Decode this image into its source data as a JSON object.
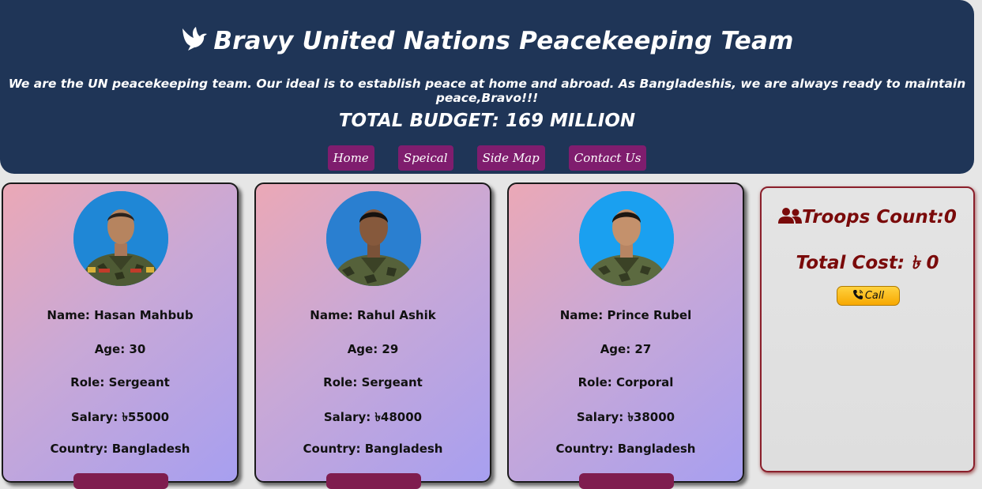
{
  "header": {
    "title": "Bravy United Nations Peacekeeping Team",
    "tagline": "We are the UN peacekeeping team. Our ideal is to establish peace at home and abroad. As Bangladeshis, we are always ready to maintain peace,Bravo!!!",
    "budget": "TOTAL BUDGET: 169 MILLION",
    "logo_icon": "dove-icon",
    "bg_color": "#1f3557"
  },
  "nav": {
    "items": [
      "Home",
      "Speical",
      "Side Map",
      "Contact Us"
    ],
    "color": "#7f1d6e"
  },
  "members": [
    {
      "name": "Name: Hasan Mahbub",
      "age": "Age: 30",
      "role": "Role: Sergeant",
      "salary": "Salary: ৳55000",
      "country": "Country: Bangladesh"
    },
    {
      "name": "Name: Rahul Ashik",
      "age": "Age: 29",
      "role": "Role: Sergeant",
      "salary": "Salary: ৳48000",
      "country": "Country: Bangladesh"
    },
    {
      "name": "Name: Prince Rubel",
      "age": "Age: 27",
      "role": "Role: Corporal",
      "salary": "Salary: ৳38000",
      "country": "Country: Bangladesh"
    }
  ],
  "side_panel": {
    "troops_count": "Troops Count:0",
    "troops_icon": "users-icon",
    "total_cost": "Total Cost: ৳ 0",
    "call_label": "Call",
    "call_icon": "phone-icon",
    "text_color": "#7a0a0a"
  }
}
